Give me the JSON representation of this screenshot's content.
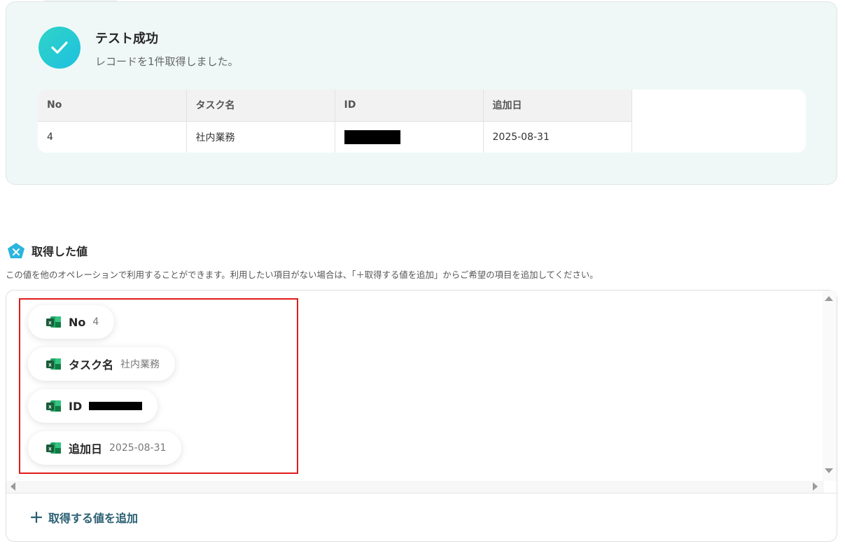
{
  "success": {
    "title": "テスト成功",
    "subtitle": "レコードを1件取得しました。"
  },
  "table": {
    "headers": [
      "No",
      "タスク名",
      "ID",
      "追加日"
    ],
    "row": [
      "4",
      "社内業務",
      "",
      "2025-08-31"
    ]
  },
  "section": {
    "title": "取得した値",
    "description": "この値を他のオペレーションで利用することができます。利用したい項目がない場合は、「＋取得する値を追加」からご希望の項目を追加してください。"
  },
  "values": [
    {
      "key": "No",
      "value": "4"
    },
    {
      "key": "タスク名",
      "value": "社内業務"
    },
    {
      "key": "ID",
      "value": ""
    },
    {
      "key": "追加日",
      "value": "2025-08-31"
    }
  ],
  "add_button": {
    "label": "取得する値を追加"
  },
  "colors": {
    "accent": "#2a5f73",
    "highlight": "#e01b1b",
    "success": "#1ec0df",
    "excel": "#1d7044"
  },
  "icons": {
    "check": "check-icon",
    "excel": "excel-icon",
    "pentagon": "yoom-x-icon",
    "plus": "plus-icon"
  }
}
